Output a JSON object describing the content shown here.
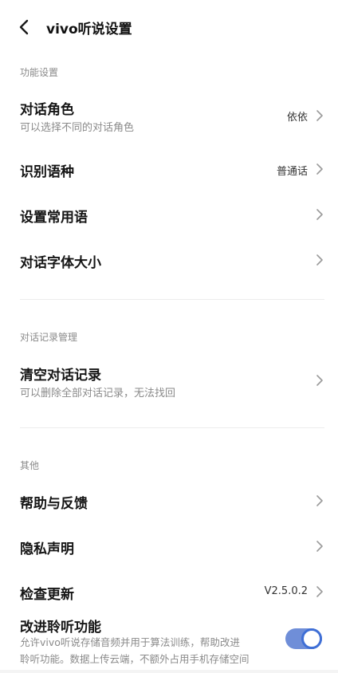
{
  "header": {
    "title": "vivo听说设置"
  },
  "sections": {
    "function": "功能设置",
    "records": "对话记录管理",
    "other": "其他"
  },
  "items": {
    "role": {
      "label": "对话角色",
      "sub": "可以选择不同的对话角色",
      "value": "依依"
    },
    "language": {
      "label": "识别语种",
      "value": "普通话"
    },
    "phrases": {
      "label": "设置常用语"
    },
    "font_size": {
      "label": "对话字体大小"
    },
    "clear": {
      "label": "清空对话记录",
      "sub": "可以删除全部对话记录，无法找回"
    },
    "help": {
      "label": "帮助与反馈"
    },
    "privacy": {
      "label": "隐私声明"
    },
    "update": {
      "label": "检查更新",
      "value": "V2.5.0.2"
    },
    "improve": {
      "label": "改进聆听功能",
      "sub1": "允许vivo听说存储音频并用于算法训练，帮助改进",
      "sub2": "聆听功能。数据上传云端，不额外占用手机存储空间",
      "enabled": true
    }
  },
  "icons": {
    "back": "back-arrow-icon",
    "chevron": "chevron-right-icon"
  },
  "colors": {
    "toggle_track": "#6f8ed8",
    "toggle_ring": "#3f6fd6"
  }
}
